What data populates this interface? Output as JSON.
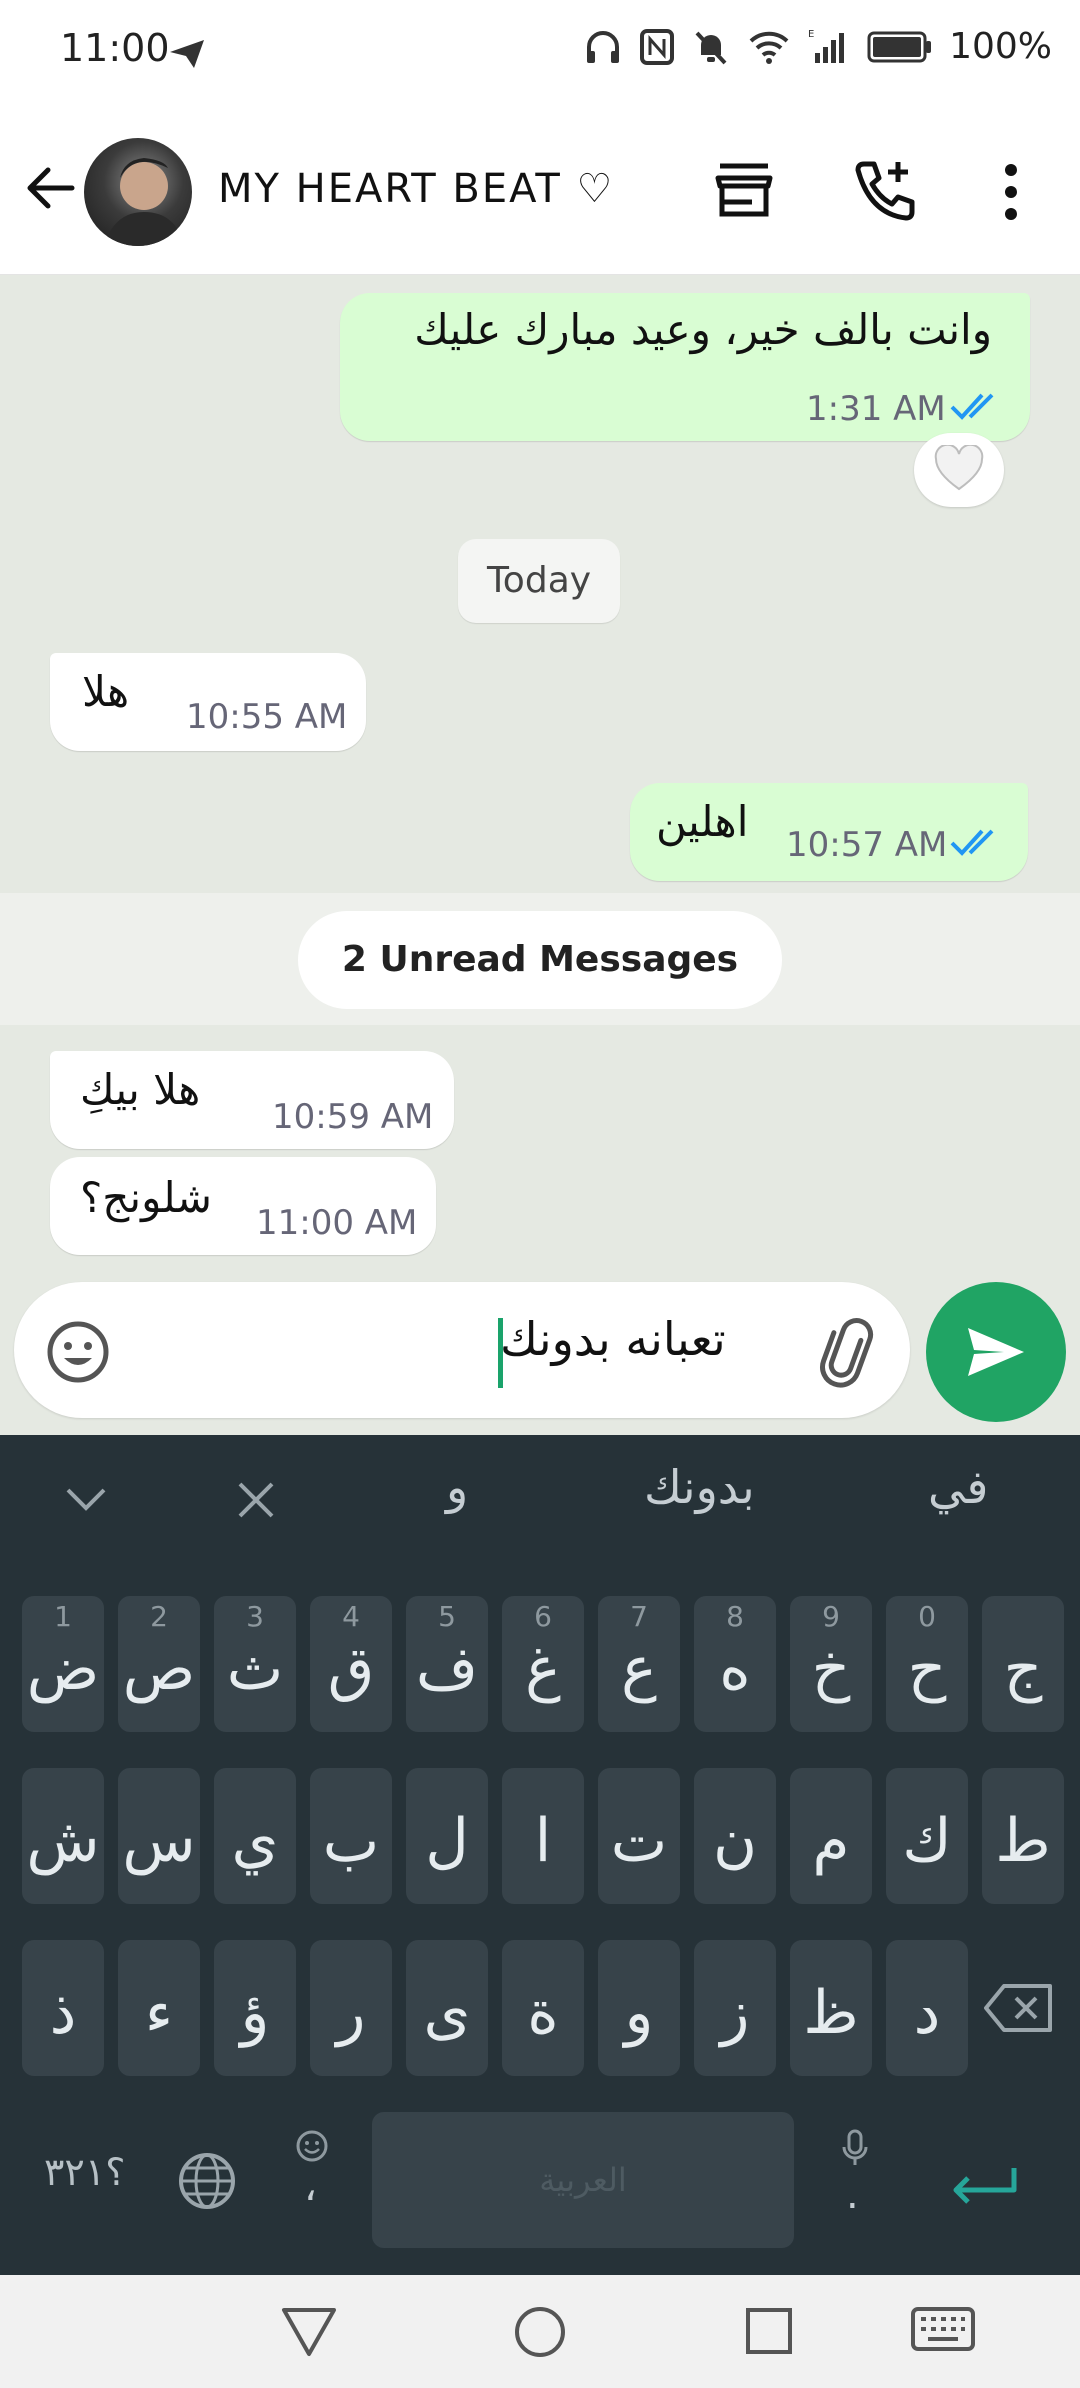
{
  "status_bar": {
    "time": "11:00",
    "battery": "100%"
  },
  "header": {
    "contact_name": "MY HEART BEAT ♡"
  },
  "messages": [
    {
      "text": "وانت بالف خير، وعيد مبارك عليك",
      "time": "1:31 AM",
      "direction": "outgoing",
      "reaction": "heart"
    },
    {
      "text": "هلا",
      "time": "10:55 AM",
      "direction": "incoming"
    },
    {
      "text": "اهلين",
      "time": "10:57 AM",
      "direction": "outgoing"
    },
    {
      "text": "هلا بيكِ",
      "time": "10:59 AM",
      "direction": "incoming"
    },
    {
      "text": "شلونج؟",
      "time": "11:00 AM",
      "direction": "incoming"
    }
  ],
  "date_separator": "Today",
  "unread_banner": "2 Unread Messages",
  "composer": {
    "text": "تعبانه بدونك"
  },
  "keyboard": {
    "suggestions": [
      "في",
      "بدونك",
      "و"
    ],
    "row1": [
      {
        "key": "ج",
        "hint": ""
      },
      {
        "key": "ح",
        "hint": "0"
      },
      {
        "key": "خ",
        "hint": "9"
      },
      {
        "key": "ه",
        "hint": "8"
      },
      {
        "key": "ع",
        "hint": "7"
      },
      {
        "key": "غ",
        "hint": "6"
      },
      {
        "key": "ف",
        "hint": "5"
      },
      {
        "key": "ق",
        "hint": "4"
      },
      {
        "key": "ث",
        "hint": "3"
      },
      {
        "key": "ص",
        "hint": "2"
      },
      {
        "key": "ض",
        "hint": "1"
      }
    ],
    "row2": [
      "ط",
      "ك",
      "م",
      "ن",
      "ت",
      "ا",
      "ل",
      "ب",
      "ي",
      "س",
      "ش"
    ],
    "row3": [
      "د",
      "ظ",
      "ز",
      "و",
      "ة",
      "ى",
      "ر",
      "ؤ",
      "ء",
      "ذ"
    ],
    "symbols_key": "؟٣٢١",
    "space_label": "العربية",
    "comma_key": "،",
    "period_key": "."
  },
  "colors": {
    "outgoing_bubble": "#d9fdd3",
    "incoming_bubble": "#ffffff",
    "chat_bg": "#e5e9e2",
    "send_button": "#20a464",
    "keyboard_bg": "#263238",
    "read_ticks": "#2196f3"
  }
}
